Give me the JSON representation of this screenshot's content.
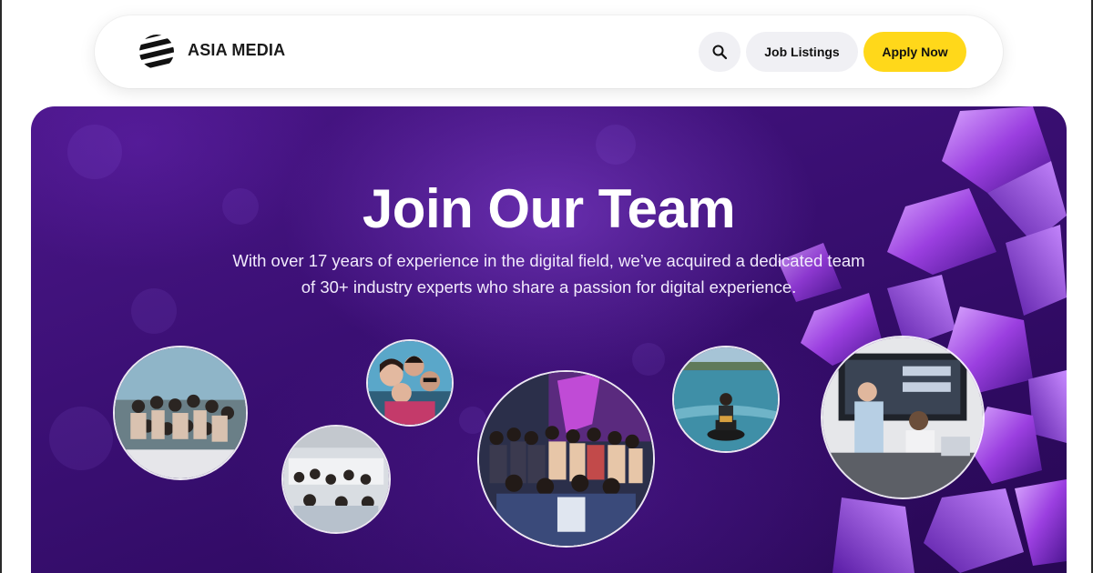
{
  "brand": {
    "name": "ASIA MEDIA",
    "logo_icon": "striped-globe-logo"
  },
  "nav": {
    "search_icon": "search-icon",
    "job_listings": "Job Listings",
    "apply_now": "Apply Now"
  },
  "hero": {
    "title": "Join Our Team",
    "description": "With over 17 years of experience in the digital field, we’ve acquired a dedicated team of 30+ industry experts who share a passion for digital experience."
  },
  "colors": {
    "accent_yellow": "#ffd81a",
    "hero_purple": "#3a0f73",
    "nav_pill": "#f0f0f4"
  },
  "photos": [
    {
      "subject": "team-boat-trip-photo"
    },
    {
      "subject": "team-selfie-photo"
    },
    {
      "subject": "team-office-meeting-photo"
    },
    {
      "subject": "team-group-photo"
    },
    {
      "subject": "jet-ski-photo"
    },
    {
      "subject": "presentation-photo"
    }
  ]
}
